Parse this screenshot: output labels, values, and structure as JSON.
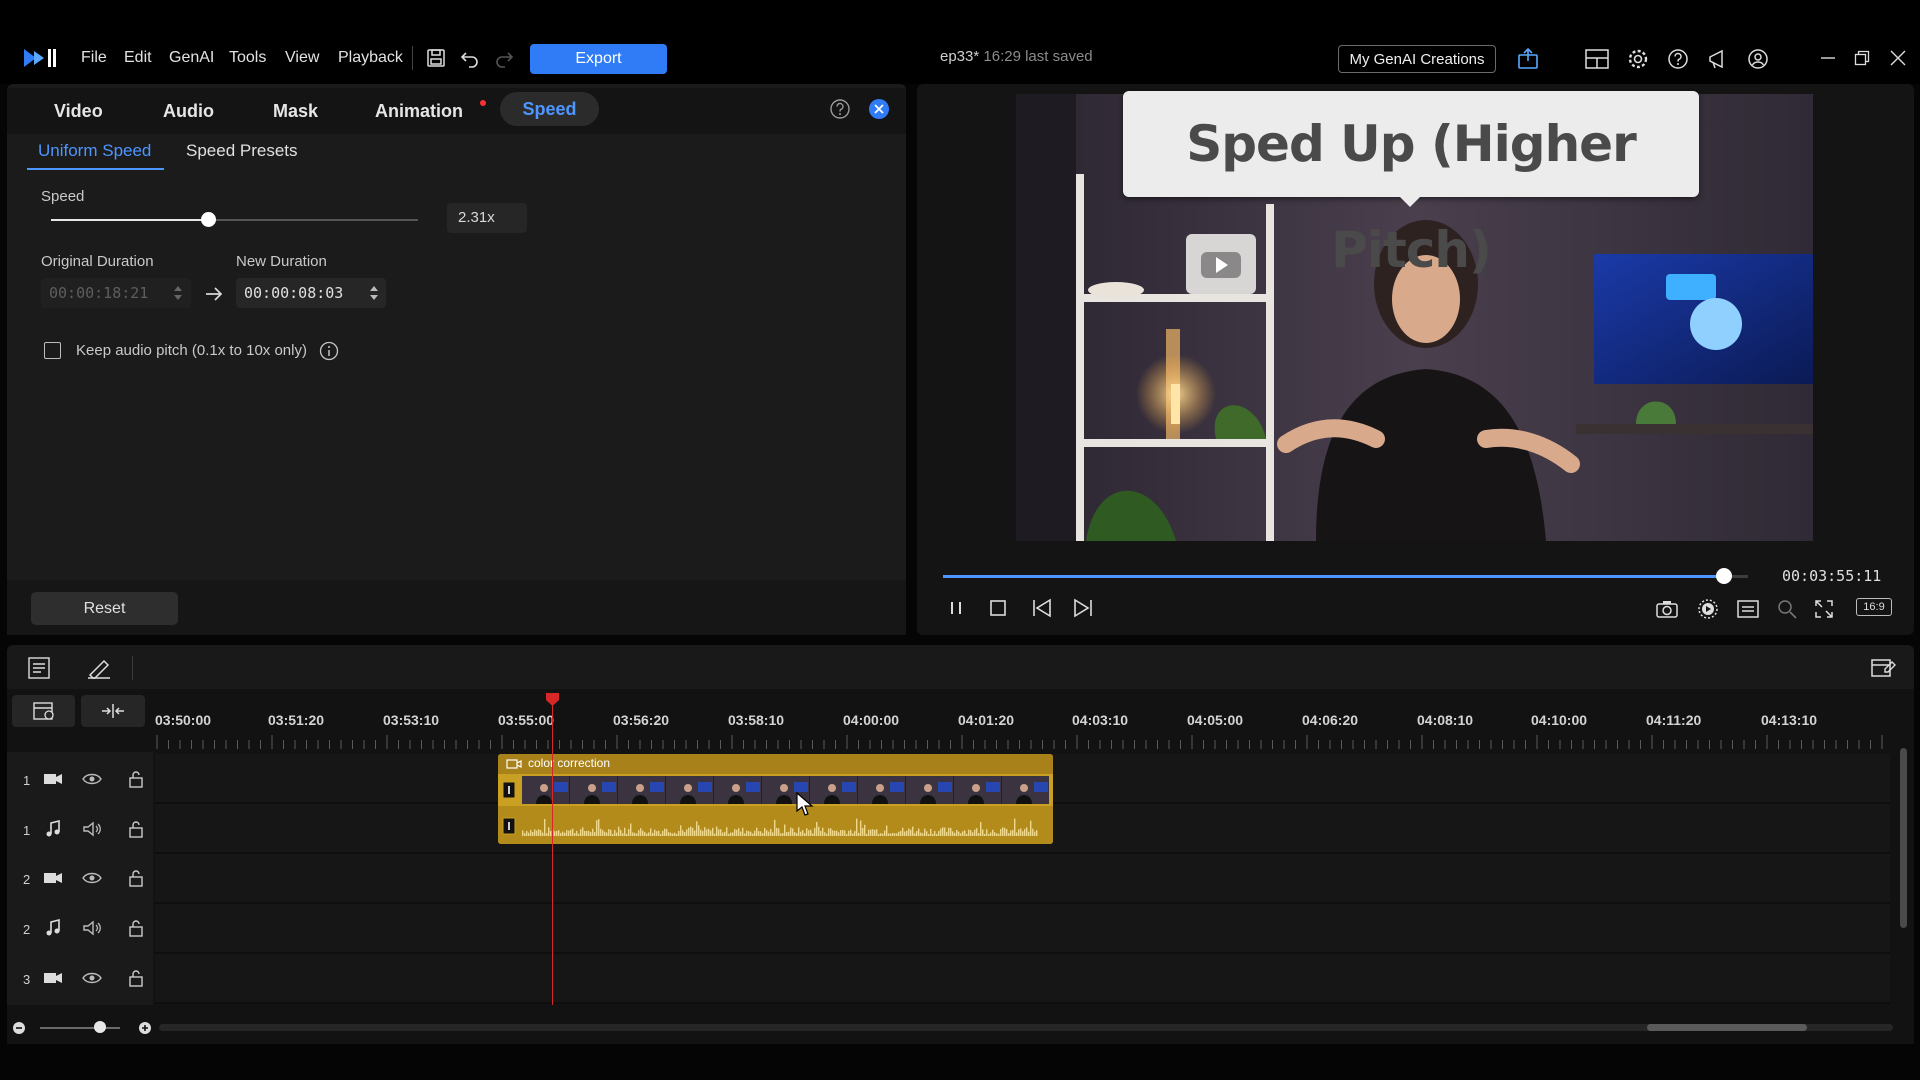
{
  "menu": {
    "file": "File",
    "edit": "Edit",
    "genai": "GenAI",
    "tools": "Tools",
    "view": "View",
    "playback": "Playback"
  },
  "toolbar": {
    "export_label": "Export",
    "genai_creations_label": "My GenAI Creations"
  },
  "document": {
    "name": "ep33*",
    "saved_text": "16:29 last saved"
  },
  "props": {
    "tabs": {
      "video": "Video",
      "audio": "Audio",
      "mask": "Mask",
      "animation": "Animation",
      "speed": "Speed"
    },
    "subtabs": {
      "uniform": "Uniform Speed",
      "presets": "Speed Presets"
    },
    "speed_label": "Speed",
    "speed_value": "2.31x",
    "speed_fraction": 0.43,
    "original_duration_label": "Original Duration",
    "original_duration": "00:00:18:21",
    "new_duration_label": "New Duration",
    "new_duration": "00:00:08:03",
    "keep_pitch_label": "Keep audio pitch (0.1x to 10x only)",
    "reset_label": "Reset"
  },
  "preview": {
    "callout_text": "Sped Up (Higher Pitch)",
    "timecode": "00:03:55:11",
    "progress": 0.97,
    "aspect_ratio": "16:9"
  },
  "timeline": {
    "ruler": [
      "03:50:00",
      "03:51:20",
      "03:53:10",
      "03:55:00",
      "03:56:20",
      "03:58:10",
      "04:00:00",
      "04:01:20",
      "04:03:10",
      "04:05:00",
      "04:06:20",
      "04:08:10",
      "04:10:00",
      "04:11:20",
      "04:13:10"
    ],
    "tracks": [
      {
        "num": "1",
        "type": "video"
      },
      {
        "num": "1",
        "type": "audio"
      },
      {
        "num": "2",
        "type": "video"
      },
      {
        "num": "2",
        "type": "audio"
      },
      {
        "num": "3",
        "type": "video"
      }
    ],
    "clip_title": "color correction"
  },
  "colors": {
    "accent": "#2f7cf6",
    "clip": "#caa022",
    "playhead": "#d62828"
  }
}
